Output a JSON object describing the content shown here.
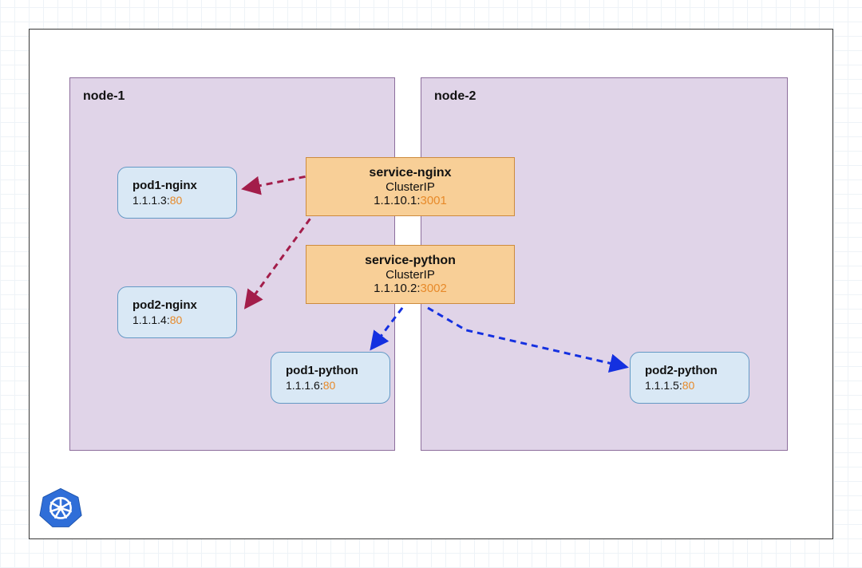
{
  "nodes": {
    "node1": {
      "label": "node-1"
    },
    "node2": {
      "label": "node-2"
    }
  },
  "pods": {
    "pod1_nginx": {
      "name": "pod1-nginx",
      "ip": "1.1.1.3:",
      "port": "80"
    },
    "pod2_nginx": {
      "name": "pod2-nginx",
      "ip": "1.1.1.4:",
      "port": "80"
    },
    "pod1_python": {
      "name": "pod1-python",
      "ip": "1.1.1.6:",
      "port": "80"
    },
    "pod2_python": {
      "name": "pod2-python",
      "ip": "1.1.1.5:",
      "port": "80"
    }
  },
  "services": {
    "nginx": {
      "name": "service-nginx",
      "type": "ClusterIP",
      "ip": "1.1.10.1:",
      "port": "3001"
    },
    "python": {
      "name": "service-python",
      "type": "ClusterIP",
      "ip": "1.1.10.2:",
      "port": "3002"
    }
  },
  "colors": {
    "arrow_red": "#a31d4a",
    "arrow_blue": "#1430e0"
  }
}
